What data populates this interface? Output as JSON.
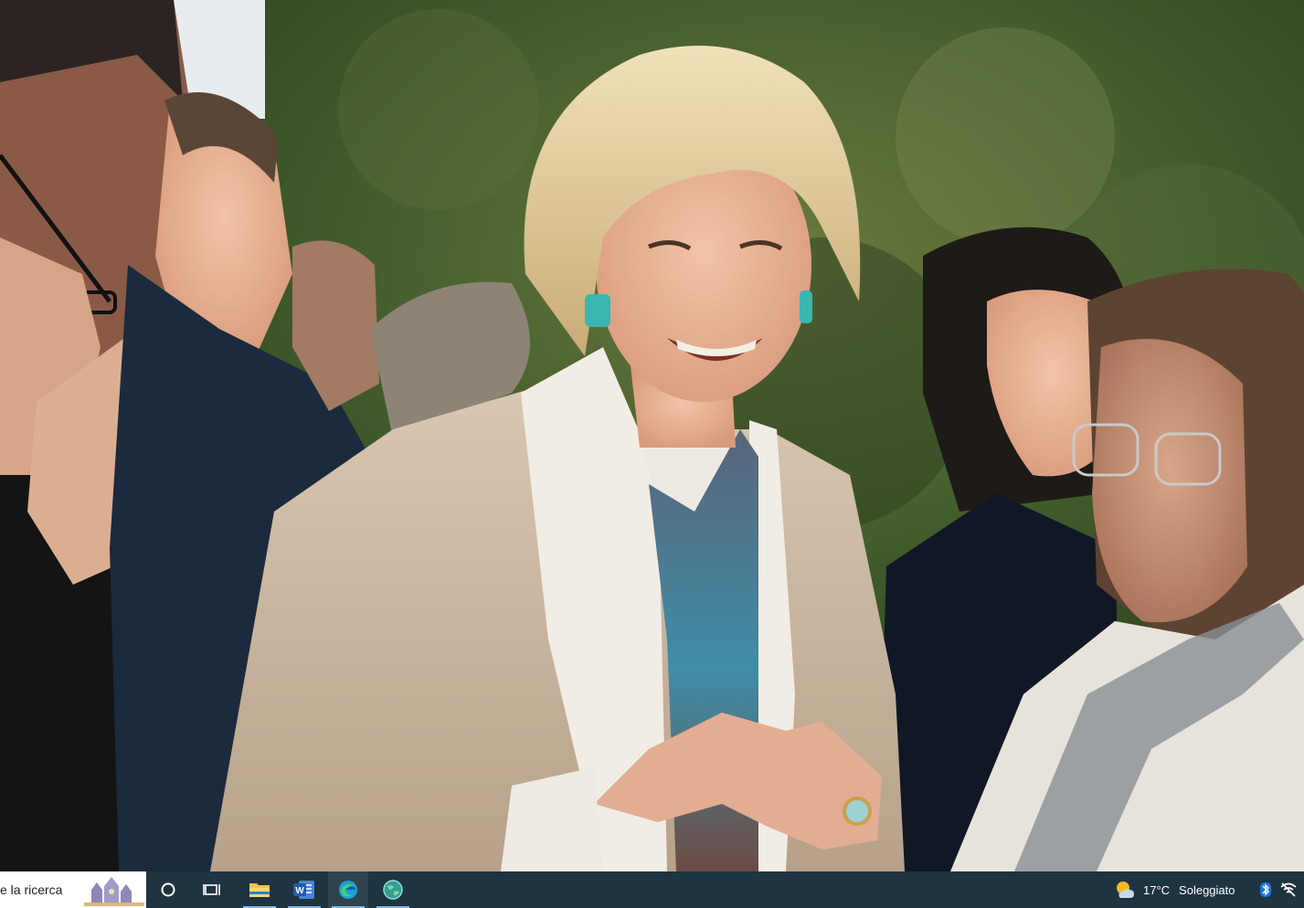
{
  "taskbar": {
    "search_text": "e la ricerca",
    "weather": {
      "temperature": "17°C",
      "condition": "Soleggiato"
    },
    "apps": [
      {
        "name": "cortana",
        "icon": "circle-icon"
      },
      {
        "name": "task-view",
        "icon": "task-view-icon"
      },
      {
        "name": "file-explorer",
        "icon": "folder-icon"
      },
      {
        "name": "word",
        "icon": "word-icon"
      },
      {
        "name": "edge",
        "icon": "edge-icon"
      },
      {
        "name": "browser",
        "icon": "globe-icon"
      }
    ],
    "colors": {
      "background": "#1e3440",
      "accent": "#7fb8e6"
    }
  }
}
